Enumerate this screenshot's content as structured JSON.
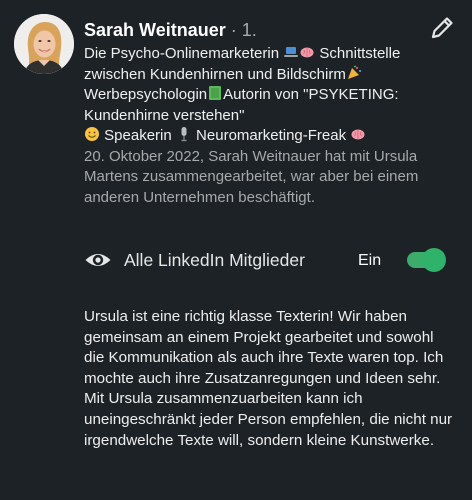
{
  "recommendation": {
    "name": "Sarah Weitnauer",
    "degree": " · 1.",
    "headline_parts": {
      "p1": "Die Psycho-Onlinemarketerin ",
      "p2": "Schnittstelle zwischen Kundenhirnen und Bildschirm",
      "p3": "Werbepsychologin",
      "p4": "Autorin von \"PSYKETING: Kundenhirne verstehen\"",
      "p5": " Speakerin ",
      "p6": " Neuromarketing-Freak "
    },
    "meta": "20. Oktober 2022, Sarah Weitnauer hat mit Ursula Martens zusammengearbeitet, war aber bei einem anderen Unternehmen beschäftigt.",
    "visibility": {
      "label": "Alle LinkedIn Mitglieder",
      "toggle_label": "Ein",
      "toggle_on": true
    },
    "text": "Ursula ist eine richtig klasse Texterin! Wir haben gemeinsam an einem Projekt gearbeitet und sowohl die Kommunikation als auch ihre Texte waren top. Ich mochte auch ihre Zusatzanregungen und Ideen sehr. Mit Ursula zusammenzuarbeiten kann ich uneingeschränkt jeder Person empfehlen, die nicht nur irgendwelche Texte will, sondern kleine Kunstwerke."
  },
  "icons": {
    "avatar": "profile-photo",
    "edit": "pencil-icon",
    "visibility": "eye-icon",
    "laptop": "laptop-emoji",
    "brain": "brain-emoji",
    "party": "party-emoji",
    "book": "green-book-emoji",
    "smile": "smiling-emoji",
    "microphone": "microphone-emoji"
  },
  "colors": {
    "background": "#1d2226",
    "toggle_on": "#2fb36a",
    "meta_text": "#a7a9ab"
  }
}
